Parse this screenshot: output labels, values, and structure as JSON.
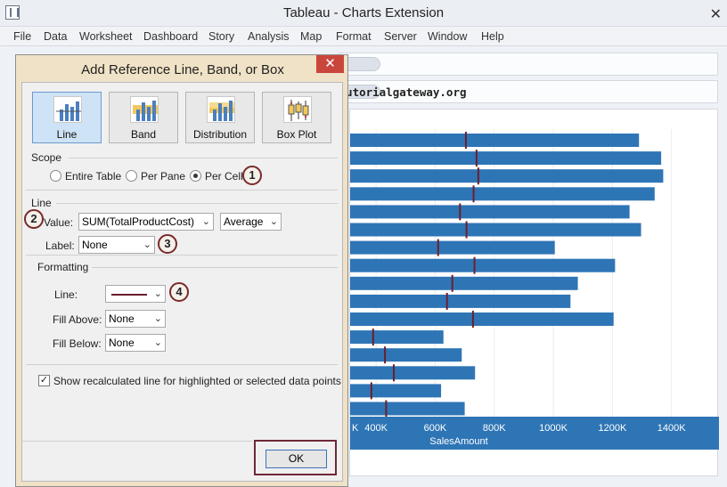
{
  "window": {
    "title": "Tableau - Charts Extension",
    "close_label": "✕"
  },
  "menu": [
    "File",
    "Data",
    "Worksheet",
    "Dashboard",
    "Story",
    "Analysis",
    "Map",
    "Format",
    "Server",
    "Window",
    "Help"
  ],
  "watermark": "©tutorialgateway.org",
  "dialog": {
    "title": "Add Reference Line, Band, or Box",
    "close_label": "✕",
    "types": [
      {
        "label": "Line",
        "selected": true
      },
      {
        "label": "Band",
        "selected": false
      },
      {
        "label": "Distribution",
        "selected": false
      },
      {
        "label": "Box Plot",
        "selected": false
      }
    ],
    "scope": {
      "heading": "Scope",
      "options": [
        "Entire Table",
        "Per Pane",
        "Per Cell"
      ],
      "selected": "Per Cell"
    },
    "line": {
      "heading": "Line",
      "value_label": "Value:",
      "value_field": "SUM(TotalProductCost)",
      "aggregation": "Average",
      "label_label": "Label:",
      "label_value": "None"
    },
    "formatting": {
      "heading": "Formatting",
      "line_label": "Line:",
      "fill_above_label": "Fill Above:",
      "fill_above_value": "None",
      "fill_below_label": "Fill Below:",
      "fill_below_value": "None"
    },
    "recalc_checkbox": {
      "label": "Show recalculated line for highlighted or selected data points",
      "checked": true
    },
    "ok_label": "OK"
  },
  "badges": [
    "1",
    "2",
    "3",
    "4"
  ],
  "chart_data": {
    "type": "bar",
    "orientation": "horizontal",
    "xlabel": "SalesAmount",
    "xlim": [
      0,
      1480000
    ],
    "ticks": [
      400000,
      600000,
      800000,
      1000000,
      1200000,
      1400000
    ],
    "tick_labels": [
      "400K",
      "600K",
      "800K",
      "1000K",
      "1200K",
      "1400K"
    ],
    "first_tick_partial": "K",
    "values": [
      1290000,
      1365000,
      1372000,
      1343000,
      1258000,
      1297000,
      1005000,
      1209000,
      1083000,
      1058000,
      1204000,
      628000,
      690000,
      735000,
      620000,
      700000
    ],
    "reference_line_values": [
      704000,
      740000,
      746000,
      730000,
      684000,
      706000,
      610000,
      733000,
      658000,
      640000,
      728000,
      390000,
      430000,
      460000,
      384000,
      434000
    ],
    "colors": {
      "bar": "#2e75b6",
      "reference_line": "#6a1f2e",
      "axis_band": "#2e75b6"
    }
  }
}
